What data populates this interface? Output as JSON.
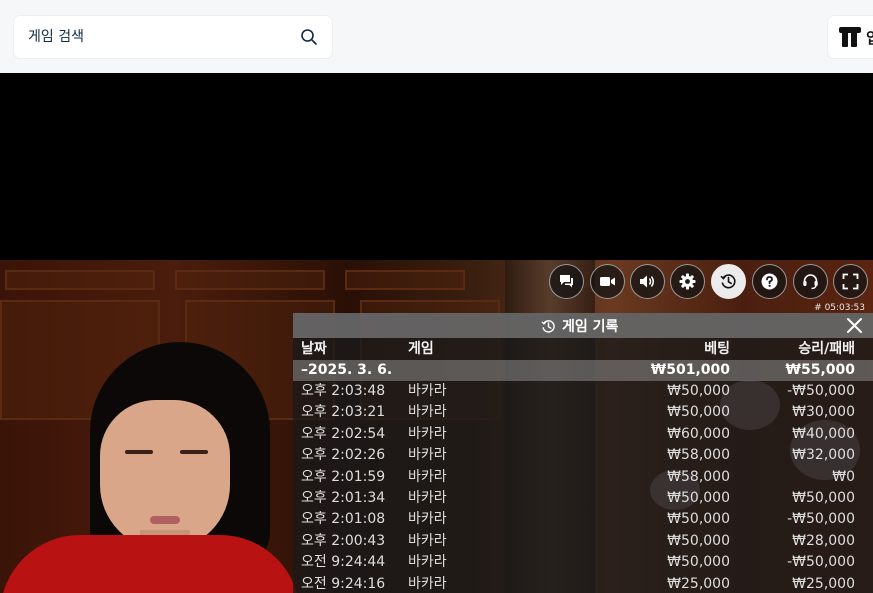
{
  "search": {
    "placeholder": "게임 검색"
  },
  "brand": {
    "label": "입"
  },
  "controls": [
    {
      "name": "chat-icon"
    },
    {
      "name": "video-camera-icon"
    },
    {
      "name": "volume-icon"
    },
    {
      "name": "settings-gear-icon"
    },
    {
      "name": "history-icon",
      "active": true
    },
    {
      "name": "help-icon"
    },
    {
      "name": "support-headset-icon"
    },
    {
      "name": "fullscreen-icon"
    }
  ],
  "stream": {
    "id": "# 05:03:53"
  },
  "history": {
    "title": "게임 기록",
    "columns": {
      "date": "날짜",
      "game": "게임",
      "bet": "베팅",
      "result": "승리/패배"
    },
    "date_group": {
      "date": "–2025. 3. 6.",
      "bet_total": "₩501,000",
      "result_total": "₩55,000"
    },
    "rows": [
      {
        "time": "오후 2:03:48",
        "game": "바카라",
        "bet": "₩50,000",
        "result": "-₩50,000"
      },
      {
        "time": "오후 2:03:21",
        "game": "바카라",
        "bet": "₩50,000",
        "result": "₩30,000"
      },
      {
        "time": "오후 2:02:54",
        "game": "바카라",
        "bet": "₩60,000",
        "result": "₩40,000"
      },
      {
        "time": "오후 2:02:26",
        "game": "바카라",
        "bet": "₩58,000",
        "result": "₩32,000"
      },
      {
        "time": "오후 2:01:59",
        "game": "바카라",
        "bet": "₩58,000",
        "result": "₩0"
      },
      {
        "time": "오후 2:01:34",
        "game": "바카라",
        "bet": "₩50,000",
        "result": "₩50,000"
      },
      {
        "time": "오후 2:01:08",
        "game": "바카라",
        "bet": "₩50,000",
        "result": "-₩50,000"
      },
      {
        "time": "오후 2:00:43",
        "game": "바카라",
        "bet": "₩50,000",
        "result": "₩28,000"
      },
      {
        "time": "오전 9:24:44",
        "game": "바카라",
        "bet": "₩50,000",
        "result": "-₩50,000"
      },
      {
        "time": "오전 9:24:16",
        "game": "바카라",
        "bet": "₩25,000",
        "result": "₩25,000"
      }
    ]
  }
}
